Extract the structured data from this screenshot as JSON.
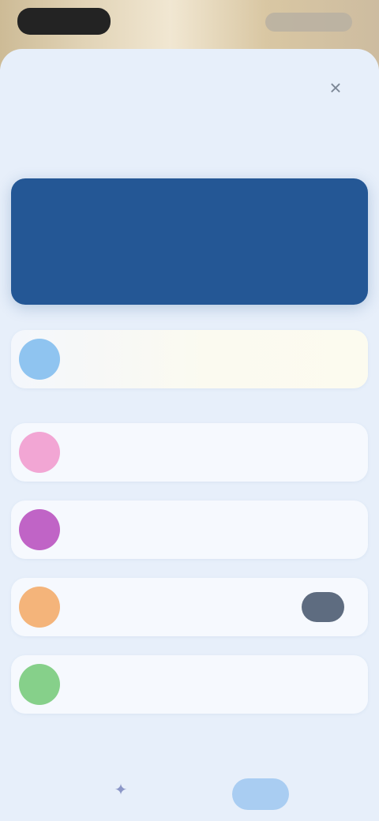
{
  "header": {
    "title": "",
    "close_icon": "close-icon"
  },
  "hero": {
    "heading": "",
    "subtext": "",
    "color": "#245795"
  },
  "settings": [
    {
      "label": "",
      "icon_color": "#8fc4f0",
      "highlighted": true
    },
    {
      "label": "",
      "icon_color": "#f2a6d4",
      "highlighted": false
    },
    {
      "label": "",
      "icon_color": "#c064c6",
      "highlighted": false
    },
    {
      "label": "",
      "icon_color": "#f4b47a",
      "highlighted": false,
      "toggle": true
    },
    {
      "label": "",
      "icon_color": "#86d08a",
      "highlighted": false
    }
  ],
  "bottom_nav": {
    "items": [
      {
        "label": ""
      },
      {
        "label": ""
      },
      {
        "label": "",
        "active": true
      },
      {
        "label": ""
      }
    ]
  }
}
